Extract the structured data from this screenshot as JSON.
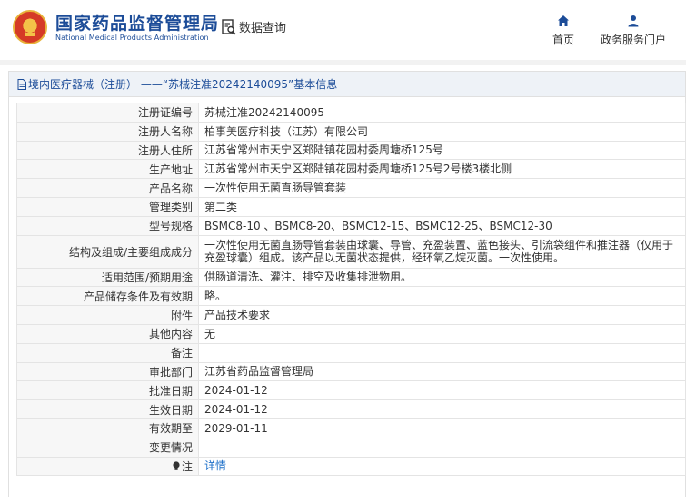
{
  "header": {
    "brand_cn": "国家药品监督管理局",
    "brand_en": "National Medical Products Administration",
    "query_label": "数据查询",
    "nav_home": "首页",
    "nav_portal": "政务服务门户"
  },
  "breadcrumb": {
    "text": "境内医疗器械（注册） ——“苏械注准20242140095”基本信息"
  },
  "rows": [
    {
      "label": "注册证编号",
      "value": "苏械注准20242140095"
    },
    {
      "label": "注册人名称",
      "value": "柏事美医疗科技（江苏）有限公司"
    },
    {
      "label": "注册人住所",
      "value": "江苏省常州市天宁区郑陆镇花园村委周塘桥125号"
    },
    {
      "label": "生产地址",
      "value": "江苏省常州市天宁区郑陆镇花园村委周塘桥125号2号楼3楼北侧"
    },
    {
      "label": "产品名称",
      "value": "一次性使用无菌直肠导管套装"
    },
    {
      "label": "管理类别",
      "value": "第二类"
    },
    {
      "label": "型号规格",
      "value": "BSMC8-10 、BSMC8-20、BSMC12-15、BSMC12-25、BSMC12-30"
    },
    {
      "label": "结构及组成/主要组成成分",
      "value": "一次性使用无菌直肠导管套装由球囊、导管、充盈装置、蓝色接头、引流袋组件和推注器（仅用于充盈球囊）组成。该产品以无菌状态提供，经环氧乙烷灭菌。一次性使用。"
    },
    {
      "label": "适用范围/预期用途",
      "value": "供肠道清洗、灌注、排空及收集排泄物用。"
    },
    {
      "label": "产品储存条件及有效期",
      "value": "略。"
    },
    {
      "label": "附件",
      "value": "产品技术要求"
    },
    {
      "label": "其他内容",
      "value": "无"
    },
    {
      "label": "备注",
      "value": ""
    },
    {
      "label": "审批部门",
      "value": "江苏省药品监督管理局"
    },
    {
      "label": "批准日期",
      "value": "2024-01-12"
    },
    {
      "label": "生效日期",
      "value": "2024-01-12"
    },
    {
      "label": "有效期至",
      "value": "2029-01-11"
    },
    {
      "label": "变更情况",
      "value": ""
    }
  ],
  "note": {
    "label": "注",
    "link": "详情"
  },
  "colors": {
    "brand_blue": "#1c4c98",
    "link_blue": "#1c6fc9",
    "label_bg": "#f7f7f7"
  }
}
